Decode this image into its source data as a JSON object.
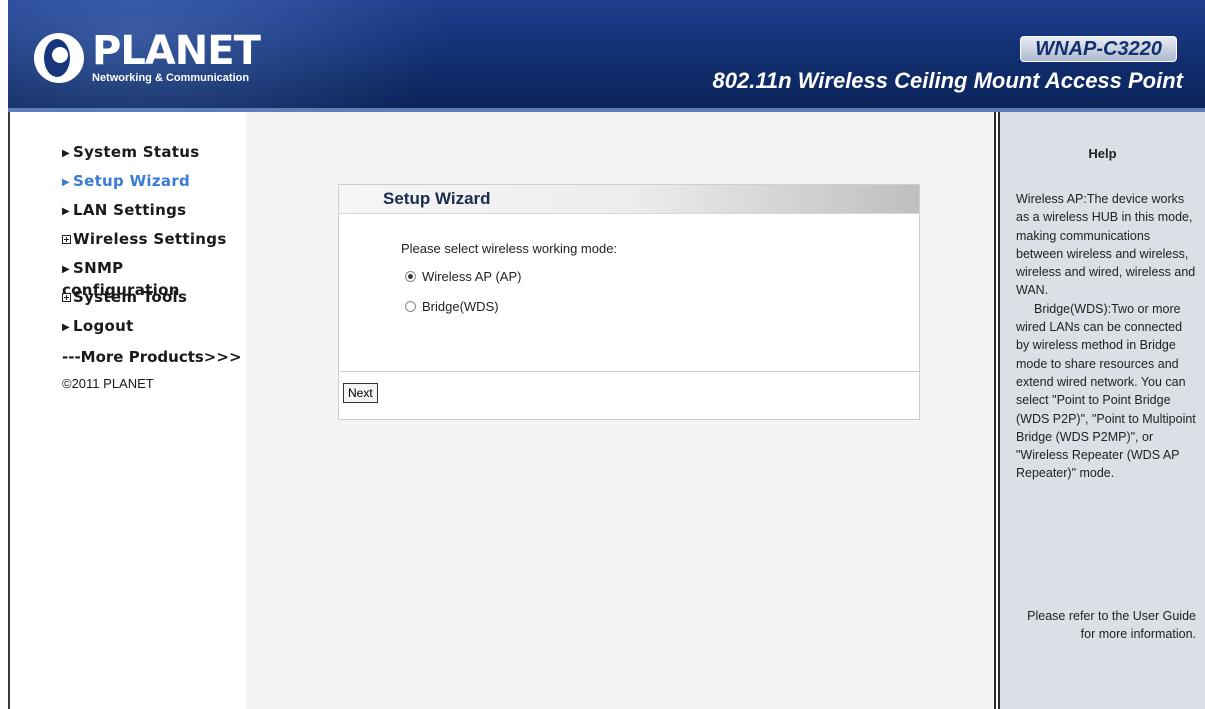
{
  "header": {
    "logo_word": "PLANET",
    "logo_sub": "Networking & Communication",
    "model": "WNAP-C3220",
    "product_title": "802.11n Wireless Ceiling Mount Access Point"
  },
  "sidebar": {
    "items": [
      {
        "label": "System Status",
        "icon": "arrow"
      },
      {
        "label": "Setup Wizard",
        "icon": "arrow",
        "active": true
      },
      {
        "label": "LAN Settings",
        "icon": "arrow"
      },
      {
        "label": "Wireless Settings",
        "icon": "plus-box"
      },
      {
        "label": "SNMP configuration",
        "icon": "arrow"
      },
      {
        "label": "System Tools",
        "icon": "plus-box"
      },
      {
        "label": "Logout",
        "icon": "arrow"
      }
    ],
    "more": "---More Products>>>",
    "copyright": "©2011 PLANET"
  },
  "wizard": {
    "title": "Setup Wizard",
    "prompt": "Please select wireless working mode:",
    "options": [
      {
        "label": "Wireless AP (AP)",
        "checked": true
      },
      {
        "label": "Bridge(WDS)",
        "checked": false
      }
    ],
    "next_label": "Next"
  },
  "help": {
    "title": "Help",
    "p1": "Wireless AP:The device works as a wireless HUB in this mode, making communications between wireless and wireless, wireless and wired, wireless and WAN.",
    "p2": "Bridge(WDS):Two or more wired LANs can be connected by wireless method in Bridge mode to share resources and extend wired network. You can select \"Point to Point Bridge (WDS P2P)\", \"Point to Multipoint Bridge (WDS P2MP)\", or \"Wireless Repeater (WDS AP Repeater)\" mode.",
    "p3": "Please refer to the User Guide for more information."
  },
  "colors": {
    "header_bg": "#17357d",
    "active_link": "#3a7bd5",
    "help_bg": "#dbe0e6",
    "main_bg": "#f4f4f4"
  }
}
